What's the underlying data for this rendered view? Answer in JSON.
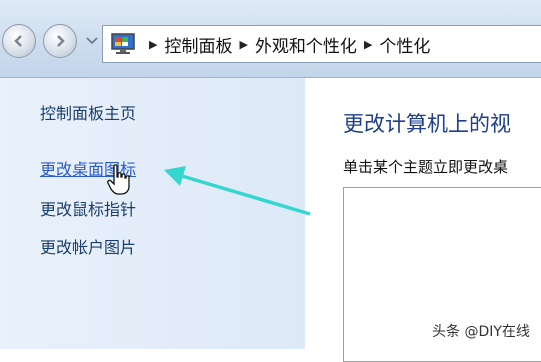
{
  "breadcrumbs": [
    "控制面板",
    "外观和个性化",
    "个性化"
  ],
  "sidebar": {
    "items": [
      {
        "label": "控制面板主页"
      },
      {
        "label": "更改桌面图标"
      },
      {
        "label": "更改鼠标指针"
      },
      {
        "label": "更改帐户图片"
      }
    ]
  },
  "main": {
    "title": "更改计算机上的视",
    "subtitle": "单击某个主题立即更改桌"
  },
  "watermark": "头条 @DIY在线",
  "colors": {
    "accent_arrow": "#35d6d0",
    "link": "#2a5ccc",
    "title": "#1e3f8a"
  },
  "icons": [
    "back-arrow-icon",
    "forward-arrow-icon",
    "chevron-down-icon",
    "monitor-icon",
    "hand-pointer-icon"
  ]
}
